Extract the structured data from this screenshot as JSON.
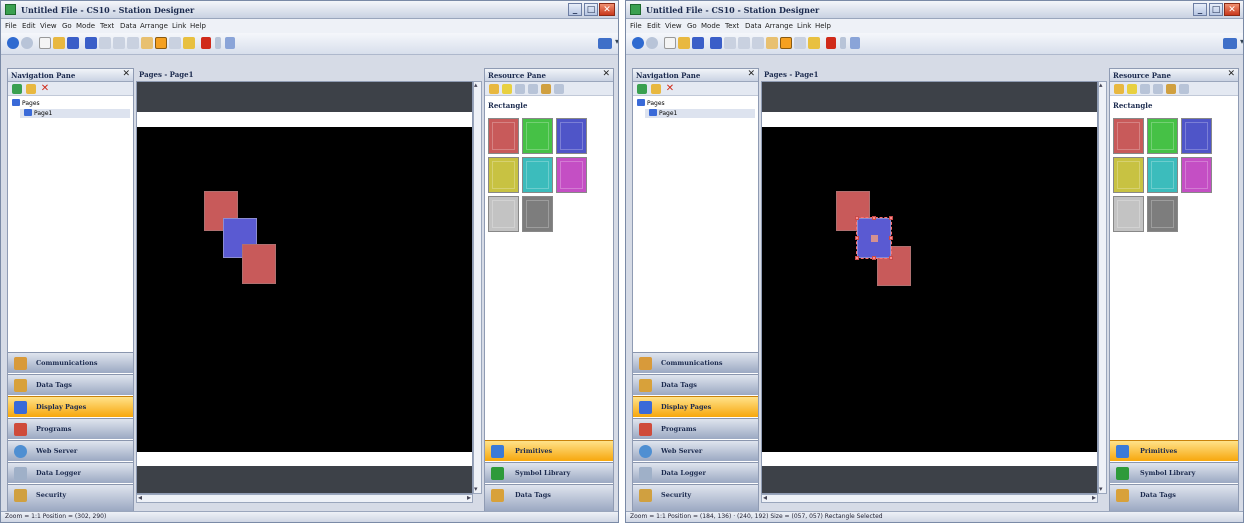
{
  "windows": [
    {
      "title": "Untitled File - CS10 - Station Designer",
      "menu": [
        "File",
        "Edit",
        "View",
        "Go",
        "Mode",
        "Text",
        "Data",
        "Arrange",
        "Link",
        "Help"
      ],
      "nav_pane": {
        "title": "Navigation Pane",
        "tree": {
          "root": "Pages",
          "child": "Page1"
        },
        "buttons": [
          {
            "label": "Communications",
            "active": false,
            "icon_color": "#d89a3a"
          },
          {
            "label": "Data Tags",
            "active": false,
            "icon_color": "#d8a13a"
          },
          {
            "label": "Display Pages",
            "active": true,
            "icon_color": "#3a6ad8"
          },
          {
            "label": "Programs",
            "active": false,
            "icon_color": "#cf4b3a"
          },
          {
            "label": "Web Server",
            "active": false,
            "icon_color": "#4f8fd2"
          },
          {
            "label": "Data Logger",
            "active": false,
            "icon_color": "#9fb0c8"
          },
          {
            "label": "Security",
            "active": false,
            "icon_color": "#d0a040"
          }
        ]
      },
      "doc": {
        "title": "Pages - Page1"
      },
      "resource_pane": {
        "title": "Resource Pane",
        "category": "Rectangle",
        "swatches": [
          "#c85a5a",
          "#46c146",
          "#4f55c8",
          "#c8c242",
          "#3cbcbc",
          "#c44fc4",
          "#c3c3c3",
          "#7d7d7d"
        ],
        "buttons": [
          {
            "label": "Primitives",
            "active": true,
            "icon_color": "#3a7ad8"
          },
          {
            "label": "Symbol Library",
            "active": false,
            "icon_color": "#2e9a3a"
          },
          {
            "label": "Data Tags",
            "active": false,
            "icon_color": "#d8a13a"
          }
        ]
      },
      "status": "Zoom = 1:1  Position = (302, 290)"
    },
    {
      "title": "Untitled File - CS10 - Station Designer",
      "menu": [
        "File",
        "Edit",
        "View",
        "Go",
        "Mode",
        "Text",
        "Data",
        "Arrange",
        "Link",
        "Help"
      ],
      "nav_pane": {
        "title": "Navigation Pane",
        "tree": {
          "root": "Pages",
          "child": "Page1"
        },
        "buttons": [
          {
            "label": "Communications",
            "active": false,
            "icon_color": "#d89a3a"
          },
          {
            "label": "Data Tags",
            "active": false,
            "icon_color": "#d8a13a"
          },
          {
            "label": "Display Pages",
            "active": true,
            "icon_color": "#3a6ad8"
          },
          {
            "label": "Programs",
            "active": false,
            "icon_color": "#cf4b3a"
          },
          {
            "label": "Web Server",
            "active": false,
            "icon_color": "#4f8fd2"
          },
          {
            "label": "Data Logger",
            "active": false,
            "icon_color": "#9fb0c8"
          },
          {
            "label": "Security",
            "active": false,
            "icon_color": "#d0a040"
          }
        ]
      },
      "doc": {
        "title": "Pages - Page1"
      },
      "resource_pane": {
        "title": "Resource Pane",
        "category": "Rectangle",
        "swatches": [
          "#c85a5a",
          "#46c146",
          "#4f55c8",
          "#c8c242",
          "#3cbcbc",
          "#c44fc4",
          "#c3c3c3",
          "#7d7d7d"
        ],
        "buttons": [
          {
            "label": "Primitives",
            "active": true,
            "icon_color": "#3a7ad8"
          },
          {
            "label": "Symbol Library",
            "active": false,
            "icon_color": "#2e9a3a"
          },
          {
            "label": "Data Tags",
            "active": false,
            "icon_color": "#d8a13a"
          }
        ]
      },
      "status": "Zoom = 1:1  Position = (184, 136) · (240, 192)  Size = (057, 057)  Rectangle Selected"
    }
  ],
  "toolbar_icons": [
    "back-icon",
    "forward-icon",
    "new-file-icon",
    "open-folder-icon",
    "save-icon",
    "print-icon",
    "cut-icon",
    "copy-icon",
    "paste-icon",
    "select-pointer-icon",
    "pan-icon",
    "zoom-icon",
    "text-tool-icon",
    "grid-icon",
    "link-icon",
    "layout-icon"
  ],
  "colors": {
    "accent": "#f7a70c",
    "canvas": "#000000",
    "chrome": "#d6dbe6"
  }
}
